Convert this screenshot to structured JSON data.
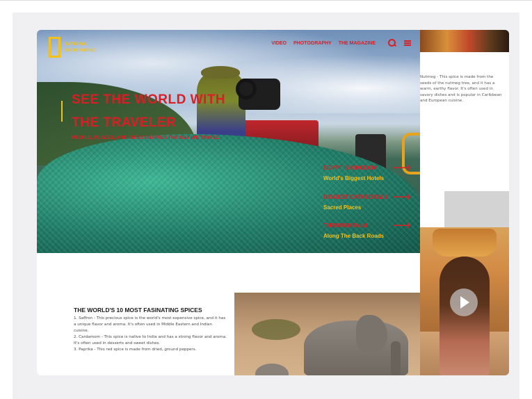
{
  "brand": {
    "name_line1": "NATIONAL",
    "name_line2": "GEOGRAPHIC"
  },
  "nav": {
    "links": [
      "VIDEO",
      "PHOTOGRAPHY",
      "THE MAGAZINE"
    ],
    "icons": [
      "search-icon",
      "menu-icon"
    ]
  },
  "hero": {
    "title_line1": "SEE THE WORLD WITH",
    "title_line2": "THE TRAVELER",
    "subtitle": "PEOPLE, PLACES, AND IDEAS SHAPING THE WAY WE TRAVEL"
  },
  "stories": [
    {
      "title": "EGYPT 'S KINGDOM",
      "subtitle": "World's Biggest Hotels"
    },
    {
      "title": "BIGGEST CATHEDRALS",
      "subtitle": "Sacred Places"
    },
    {
      "title": "THROUGH Road",
      "subtitle": "Along The Back Roads"
    }
  ],
  "sidebar": {
    "nutmeg_text": "Nutmeg - This spice is made from the seeds of the nutmeg tree, and it has a warm, earthy flavor. It's often used in savory dishes and is popular in Caribbean and European cuisine."
  },
  "spices": {
    "title": "THE  WORLD'S 10 MOST FASINATING SPICES",
    "items": [
      "1. Saffron - This precious spice is the world's most expensive spice, and it has a unique flavor and aroma. It's often used in Middle Eastern and Indian cuisine.",
      "2. Cardamom - This spice is native to India and has a strong flavor and aroma. It's often used in desserts and sweet dishes.",
      "3. Paprika - This red spice is made from dried, ground peppers."
    ]
  },
  "colors": {
    "accent_red": "#d81f26",
    "accent_yellow": "#f3c21a",
    "canvas": "#f0f0f3"
  }
}
